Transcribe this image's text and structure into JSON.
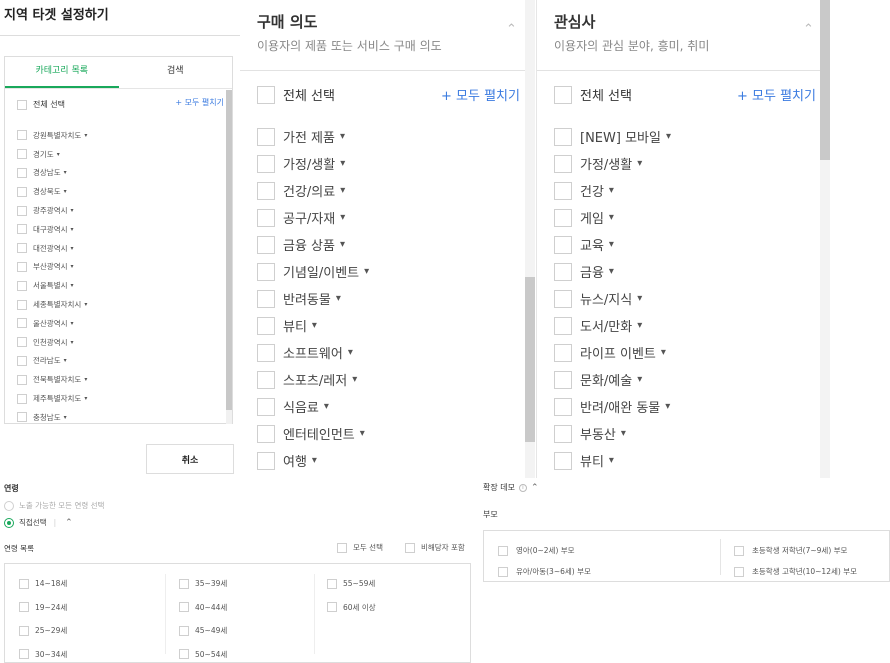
{
  "left_panel": {
    "title": "지역 타겟 설정하기",
    "tabs": [
      {
        "label": "카테고리 목록",
        "active": true
      },
      {
        "label": "검색",
        "active": false
      }
    ],
    "select_all": "전체 선택",
    "expand_all": "+ 모두 펼치기",
    "regions": [
      "강원특별자치도",
      "경기도",
      "경상남도",
      "경상북도",
      "광주광역시",
      "대구광역시",
      "대전광역시",
      "부산광역시",
      "서울특별시",
      "세종특별자치시",
      "울산광역시",
      "인천광역시",
      "전라남도",
      "전북특별자치도",
      "제주특별자치도",
      "충청남도"
    ],
    "cancel_button": "취소"
  },
  "purchase_intent": {
    "title": "구매 의도",
    "subtitle": "이용자의 제품 또는 서비스 구매 의도",
    "select_all": "전체 선택",
    "expand_all": "+ 모두 펼치기",
    "items": [
      "가전 제품",
      "가정/생활",
      "건강/의료",
      "공구/자재",
      "금융 상품",
      "기념일/이벤트",
      "반려동물",
      "뷰티",
      "소프트웨어",
      "스포츠/레저",
      "식음료",
      "엔터테인먼트",
      "여행"
    ]
  },
  "interests": {
    "title": "관심사",
    "subtitle": "이용자의 관심 분야, 흥미, 취미",
    "select_all": "전체 선택",
    "expand_all": "+ 모두 펼치기",
    "items": [
      "[NEW] 모바일",
      "가정/생활",
      "건강",
      "게임",
      "교육",
      "금융",
      "뉴스/지식",
      "도서/만화",
      "라이프 이벤트",
      "문화/예술",
      "반려/애완 동물",
      "부동산",
      "뷰티"
    ]
  },
  "age": {
    "label": "연령",
    "option_all": "노출 가능한 모든 연령 선택",
    "option_direct": "직접선택",
    "list_label": "연령 목록",
    "select_all": "모두 선택",
    "include_non_target": "비해당자 포함",
    "columns": [
      [
        "14~18세",
        "19~24세",
        "25~29세",
        "30~34세"
      ],
      [
        "35~39세",
        "40~44세",
        "45~49세",
        "50~54세"
      ],
      [
        "55~59세",
        "60세 이상"
      ]
    ]
  },
  "extended_demo": {
    "label": "확장 데모",
    "info_icon": "i",
    "parent_label": "부모",
    "left_items": [
      "영아(0~2세) 부모",
      "유아/아동(3~6세) 부모"
    ],
    "right_items": [
      "초등학생 저학년(7~9세) 부모",
      "초등학생 고학년(10~12세) 부모"
    ]
  },
  "colors": {
    "accent_green": "#19a85b",
    "link_blue": "#3b7be0"
  }
}
